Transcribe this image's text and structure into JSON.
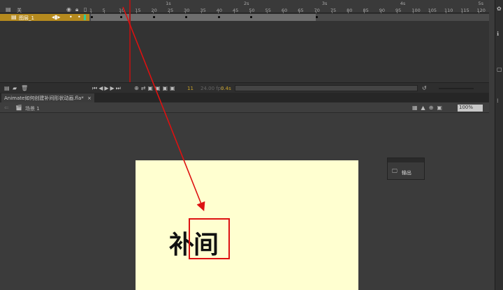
{
  "timeline": {
    "header_label": "关",
    "layer_name": "图层_1",
    "frame_ticks": [
      1,
      5,
      10,
      15,
      20,
      25,
      30,
      35,
      40,
      45,
      50,
      55,
      60,
      65,
      70,
      75,
      80,
      85,
      90,
      95,
      100,
      105,
      110,
      115,
      120
    ],
    "second_labels": [
      "1s",
      "2s",
      "3s",
      "4s",
      "5s"
    ],
    "current_frame_marker": 13,
    "keyframes": [
      1,
      10,
      20,
      30,
      40,
      50,
      70
    ],
    "tween_end_frame": 70,
    "status": {
      "frame": "11",
      "fps": "24.00 fps",
      "time": "0.4s"
    }
  },
  "document_tab": {
    "title": "Animate如何创建补间形状动画.fla*",
    "close": "×"
  },
  "scene": {
    "label": "场景 1",
    "zoom": "100%"
  },
  "stage": {
    "text": "补间",
    "bg": "#ffffd0"
  },
  "output_panel": {
    "label": "输出"
  },
  "colors": {
    "arrow": "#d11",
    "layer": "#b58a1e"
  }
}
